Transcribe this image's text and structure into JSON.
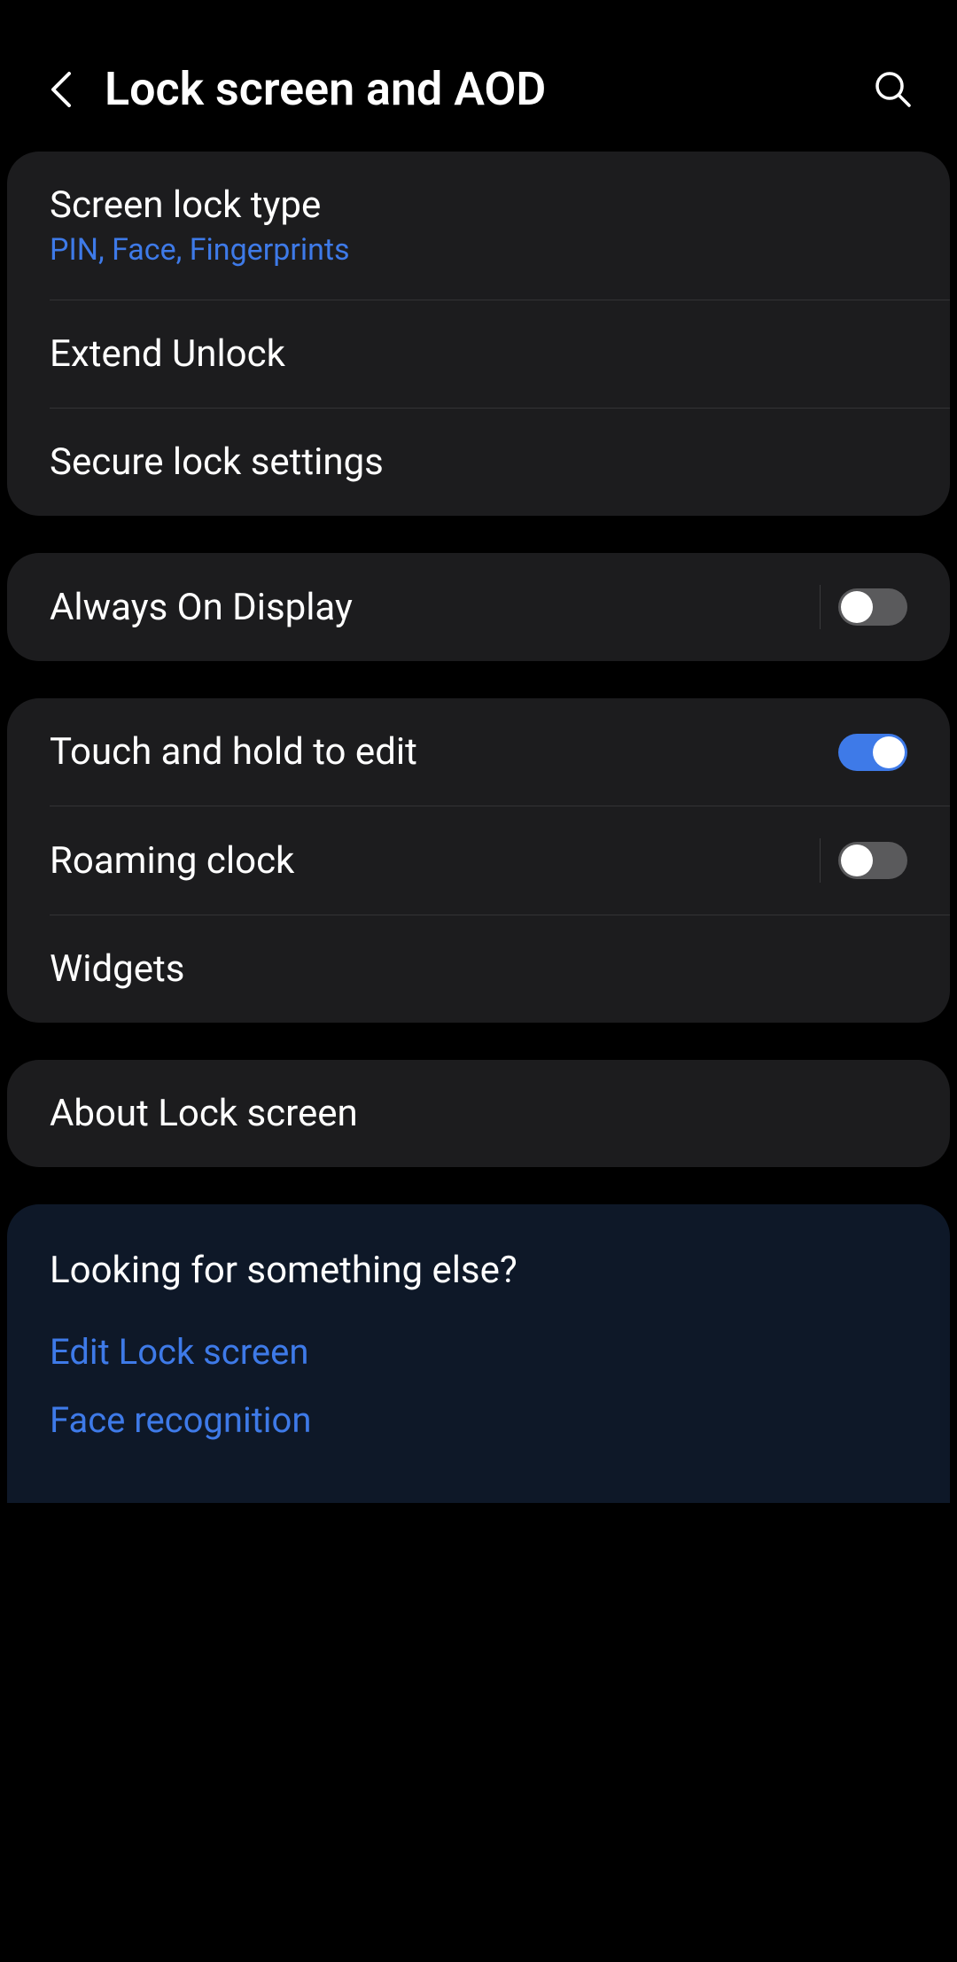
{
  "header": {
    "title": "Lock screen and AOD"
  },
  "section1": {
    "screenLockType": {
      "title": "Screen lock type",
      "subtitle": "PIN, Face, Fingerprints"
    },
    "extendUnlock": {
      "title": "Extend Unlock"
    },
    "secureLockSettings": {
      "title": "Secure lock settings"
    }
  },
  "section2": {
    "alwaysOnDisplay": {
      "title": "Always On Display",
      "enabled": false
    }
  },
  "section3": {
    "touchHoldEdit": {
      "title": "Touch and hold to edit",
      "enabled": true
    },
    "roamingClock": {
      "title": "Roaming clock",
      "enabled": false
    },
    "widgets": {
      "title": "Widgets"
    }
  },
  "section4": {
    "aboutLockScreen": {
      "title": "About Lock screen"
    }
  },
  "lookingFor": {
    "title": "Looking for something else?",
    "links": {
      "editLockScreen": "Edit Lock screen",
      "faceRecognition": "Face recognition"
    }
  }
}
